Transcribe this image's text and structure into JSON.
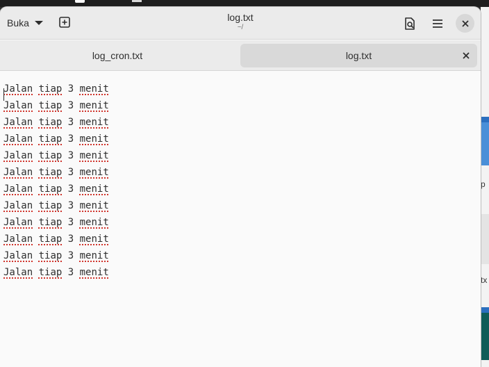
{
  "header": {
    "open_label": "Buka",
    "title": "log.txt",
    "subtitle": "~/"
  },
  "tabs": [
    {
      "label": "log_cron.txt",
      "active": false
    },
    {
      "label": "log.txt",
      "active": true
    }
  ],
  "document": {
    "lines": [
      {
        "w1": "Jalan",
        "w2": "tiap",
        "w3": "3",
        "w4": "menit"
      },
      {
        "w1": "Jalan",
        "w2": "tiap",
        "w3": "3",
        "w4": "menit"
      },
      {
        "w1": "Jalan",
        "w2": "tiap",
        "w3": "3",
        "w4": "menit"
      },
      {
        "w1": "Jalan",
        "w2": "tiap",
        "w3": "3",
        "w4": "menit"
      },
      {
        "w1": "Jalan",
        "w2": "tiap",
        "w3": "3",
        "w4": "menit"
      },
      {
        "w1": "Jalan",
        "w2": "tiap",
        "w3": "3",
        "w4": "menit"
      },
      {
        "w1": "Jalan",
        "w2": "tiap",
        "w3": "3",
        "w4": "menit"
      },
      {
        "w1": "Jalan",
        "w2": "tiap",
        "w3": "3",
        "w4": "menit"
      },
      {
        "w1": "Jalan",
        "w2": "tiap",
        "w3": "3",
        "w4": "menit"
      },
      {
        "w1": "Jalan",
        "w2": "tiap",
        "w3": "3",
        "w4": "menit"
      },
      {
        "w1": "Jalan",
        "w2": "tiap",
        "w3": "3",
        "w4": "menit"
      },
      {
        "w1": "Jalan",
        "w2": "tiap",
        "w3": "3",
        "w4": "menit"
      }
    ]
  },
  "peek": {
    "text_a": "p",
    "text_b": "tx"
  },
  "icons": {
    "open_caret": "chevron-down-icon",
    "new_tab": "new-tab-icon",
    "search": "document-search-icon",
    "menu": "hamburger-menu-icon",
    "close": "close-icon",
    "tab_close": "close-icon"
  },
  "colors": {
    "headerbar": "#ebebeb",
    "editor_bg": "#fafafa",
    "active_tab": "#d9d9d9",
    "spell_underline": "#d0332b"
  }
}
